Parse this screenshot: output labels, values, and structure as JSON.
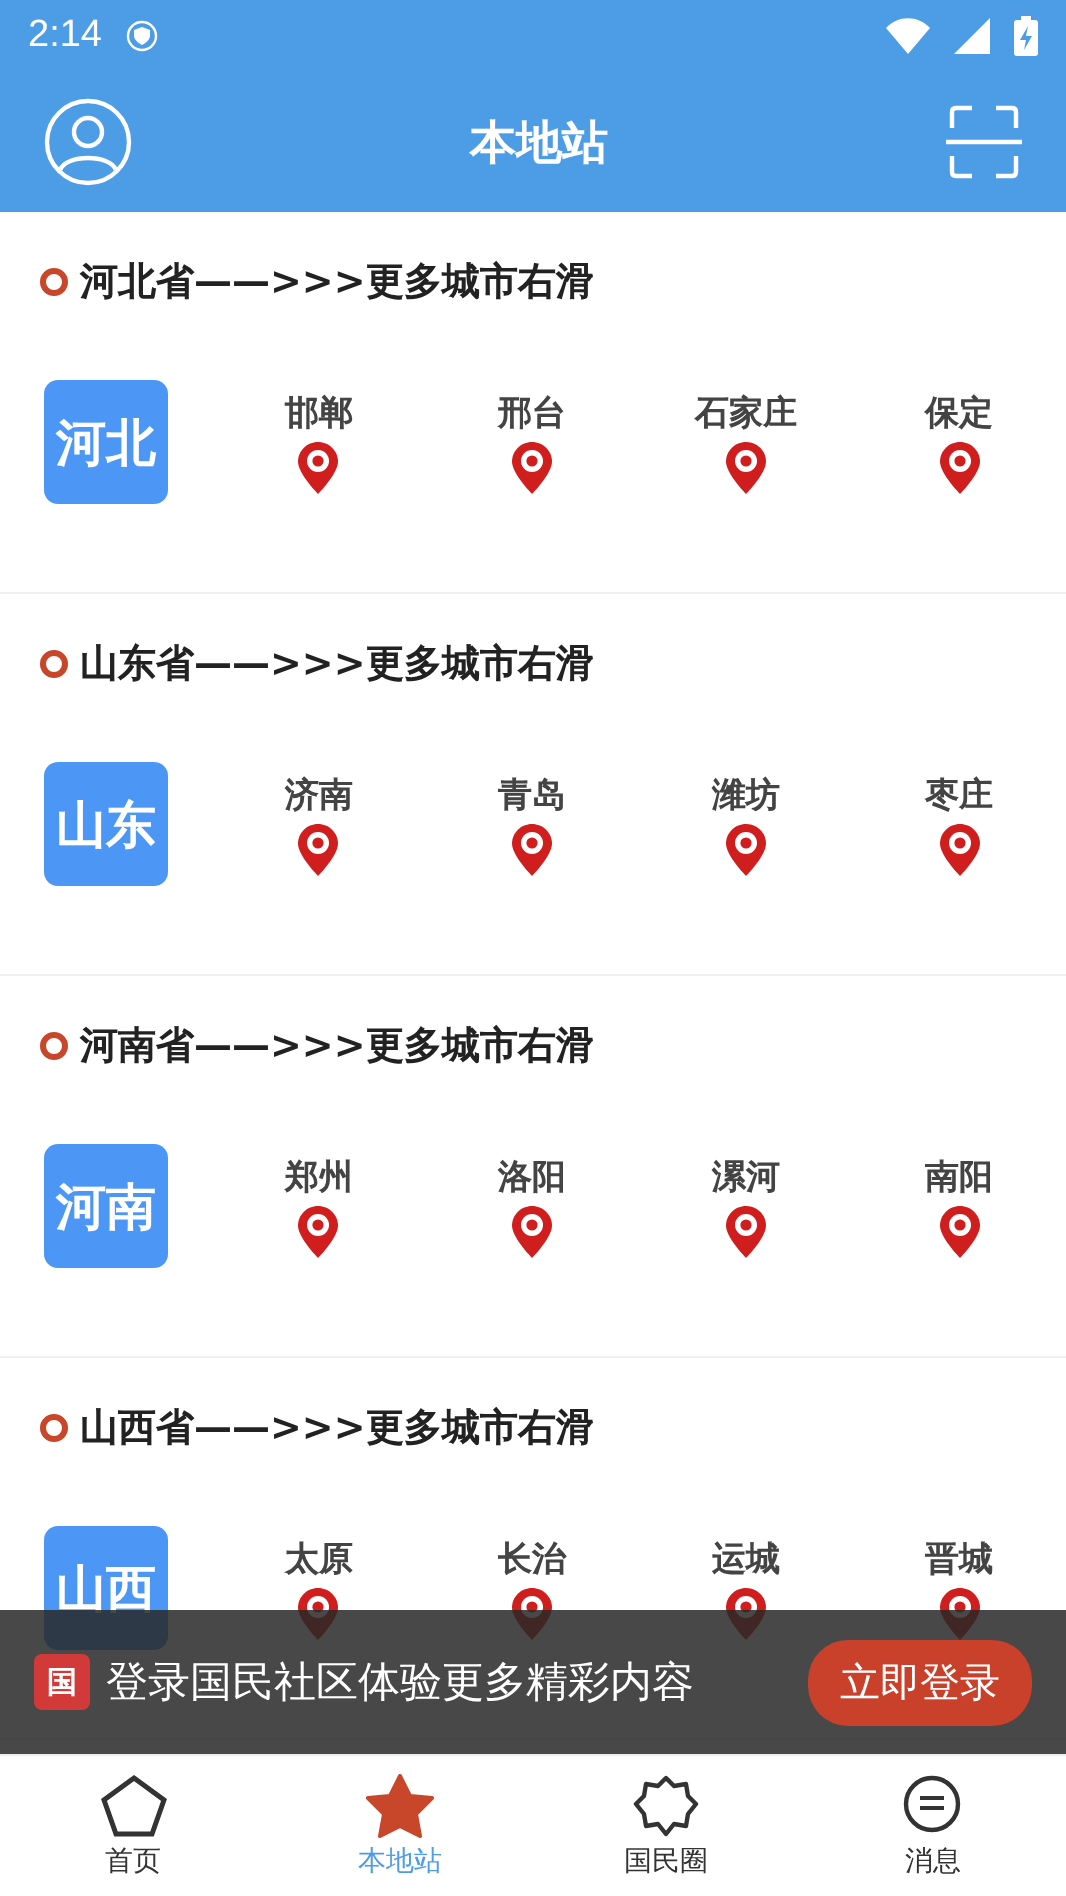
{
  "status_bar": {
    "time": "2:14"
  },
  "header": {
    "title": "本地站"
  },
  "provinces": [
    {
      "title": "河北省——>>>更多城市右滑",
      "badge": "河北",
      "cities": [
        "邯郸",
        "邢台",
        "石家庄",
        "保定"
      ]
    },
    {
      "title": "山东省——>>>更多城市右滑",
      "badge": "山东",
      "cities": [
        "济南",
        "青岛",
        "潍坊",
        "枣庄"
      ]
    },
    {
      "title": "河南省——>>>更多城市右滑",
      "badge": "河南",
      "cities": [
        "郑州",
        "洛阳",
        "漯河",
        "南阳"
      ]
    },
    {
      "title": "山西省——>>>更多城市右滑",
      "badge": "山西",
      "cities": [
        "太原",
        "长治",
        "运城",
        "晋城"
      ]
    }
  ],
  "login_banner": {
    "logo": "国",
    "text": "登录国民社区体验更多精彩内容",
    "button": "立即登录"
  },
  "bottom_nav": [
    {
      "kind": "pentagon",
      "label": "首页",
      "selected": false
    },
    {
      "kind": "star",
      "label": "本地站",
      "selected": true
    },
    {
      "kind": "badge",
      "label": "国民圈",
      "selected": false
    },
    {
      "kind": "chat",
      "label": "消息",
      "selected": false
    }
  ]
}
